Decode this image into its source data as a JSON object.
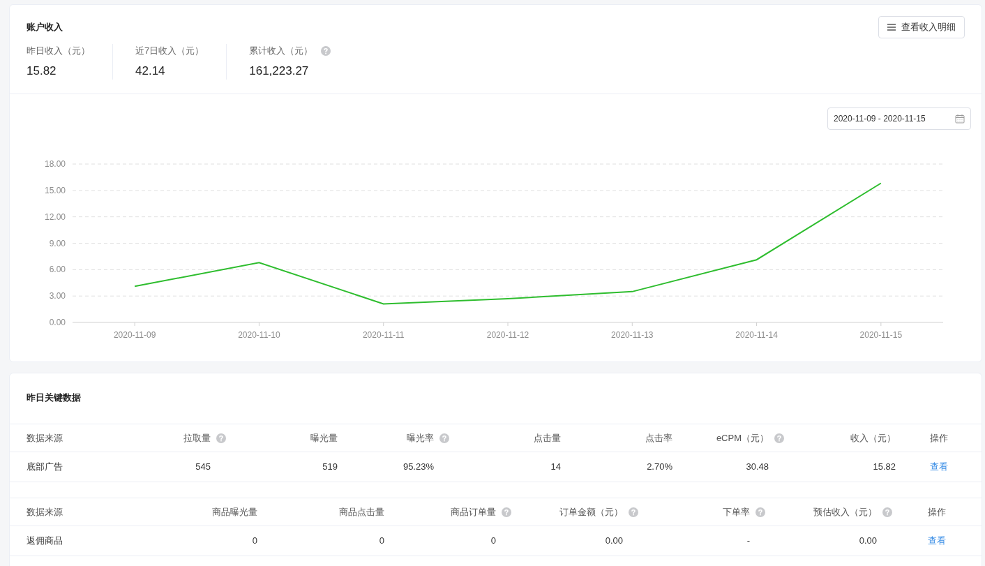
{
  "income": {
    "title": "账户收入",
    "detail_button": "查看收入明细",
    "stats": [
      {
        "label": "昨日收入（元）",
        "value": "15.82",
        "help": false
      },
      {
        "label": "近7日收入（元）",
        "value": "42.14",
        "help": false
      },
      {
        "label": "累计收入（元）",
        "value": "161,223.27",
        "help": true
      }
    ],
    "date_range": "2020-11-09 - 2020-11-15",
    "chart_data": {
      "type": "line",
      "categories": [
        "2020-11-09",
        "2020-11-10",
        "2020-11-11",
        "2020-11-12",
        "2020-11-13",
        "2020-11-14",
        "2020-11-15"
      ],
      "grid": true,
      "series": [
        {
          "color": "#2ebd2e",
          "values": [
            4.1,
            6.8,
            2.1,
            2.7,
            3.5,
            7.12,
            15.82
          ]
        }
      ],
      "ylim": [
        0,
        18
      ],
      "yticks": [
        {
          "value": 0,
          "label": "0.00"
        },
        {
          "value": 3,
          "label": "3.00"
        },
        {
          "value": 6,
          "label": "6.00"
        },
        {
          "value": 9,
          "label": "9.00"
        },
        {
          "value": 12,
          "label": "12.00"
        },
        {
          "value": 15,
          "label": "15.00"
        },
        {
          "value": 18,
          "label": "18.00"
        }
      ]
    }
  },
  "key_data": {
    "title": "昨日关键数据",
    "tables": [
      {
        "columns": [
          {
            "label": "数据来源",
            "help": false
          },
          {
            "label": "拉取量",
            "help": true
          },
          {
            "label": "曝光量",
            "help": false
          },
          {
            "label": "曝光率",
            "help": true
          },
          {
            "label": "点击量",
            "help": false
          },
          {
            "label": "点击率",
            "help": false
          },
          {
            "label": "eCPM（元）",
            "help": true
          },
          {
            "label": "收入（元）",
            "help": false
          },
          {
            "label": "操作",
            "help": false
          }
        ],
        "rows": [
          {
            "cells": [
              "底部广告",
              "545",
              "519",
              "95.23%",
              "14",
              "2.70%",
              "30.48",
              "15.82"
            ],
            "action": "查看"
          }
        ]
      },
      {
        "columns": [
          {
            "label": "数据来源",
            "help": false
          },
          {
            "label": "商品曝光量",
            "help": false
          },
          {
            "label": "商品点击量",
            "help": false
          },
          {
            "label": "商品订单量",
            "help": true
          },
          {
            "label": "订单金额（元）",
            "help": true
          },
          {
            "label": "下单率",
            "help": true
          },
          {
            "label": "预估收入（元）",
            "help": true
          },
          {
            "label": "操作",
            "help": false
          }
        ],
        "rows": [
          {
            "cells": [
              "返佣商品",
              "0",
              "0",
              "0",
              "0.00",
              "-",
              "0.00"
            ],
            "action": "查看"
          }
        ]
      }
    ]
  }
}
